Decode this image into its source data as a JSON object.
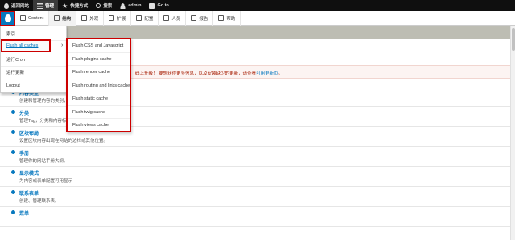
{
  "toolbar": {
    "items": [
      {
        "label": "返回网站",
        "icon": "drop-icon"
      },
      {
        "label": "管理",
        "icon": "menu-icon"
      },
      {
        "label": "快捷方式",
        "icon": "star-icon"
      },
      {
        "label": "搜索",
        "icon": "search-icon"
      },
      {
        "label": "admin",
        "icon": "user-icon"
      },
      {
        "label": "Go to",
        "icon": "goto-icon"
      }
    ]
  },
  "tray": {
    "items": [
      {
        "label": "Content"
      },
      {
        "label": "结构"
      },
      {
        "label": "外观"
      },
      {
        "label": "扩展"
      },
      {
        "label": "配置"
      },
      {
        "label": "人员"
      },
      {
        "label": "报告"
      },
      {
        "label": "帮助"
      }
    ]
  },
  "breadcrumb": "索引",
  "message": {
    "text": "码上升级！ 要想获得更多信息，以及安装缺少的更新，请查看",
    "link": "可用更新页",
    "tail": "。"
  },
  "admin_menu": {
    "items": [
      "索引",
      "Flush all caches",
      "运行Cron",
      "运行更新",
      "Logout"
    ],
    "chevron": "›"
  },
  "flush_menu": {
    "items": [
      "Flush CSS and Javascript",
      "Flush plugins cache",
      "Flush render cache",
      "Flush routing and links cache",
      "Flush static cache",
      "Flush twig cache",
      "Flush views cache"
    ]
  },
  "entries": [
    {
      "title": "内容类型",
      "desc": "创建和管理内容的类别，例如"
    },
    {
      "title": "分类",
      "desc": "管理Tag，分类和内容标签"
    },
    {
      "title": "区块布局",
      "desc": "设置区块内容出现在网站的边栏或其他位置。"
    },
    {
      "title": "手册",
      "desc": "管理你的网站手册大纲。"
    },
    {
      "title": "显示模式",
      "desc": "为内容或表单配置可用显示"
    },
    {
      "title": "联系表单",
      "desc": "创建、管理联系表。"
    },
    {
      "title": "菜单",
      "desc": ""
    }
  ],
  "colors": {
    "accent": "#0678be",
    "highlight": "#cc0000",
    "link": "#0074bd"
  }
}
